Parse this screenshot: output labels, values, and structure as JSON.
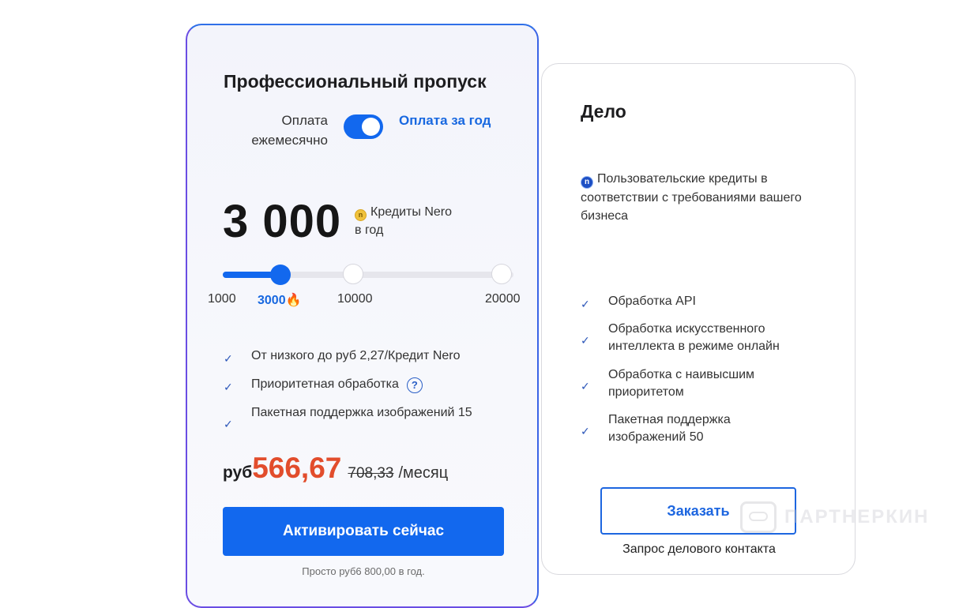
{
  "pro_card": {
    "title": "Профессиональный пропуск",
    "billing_monthly": "Оплата ежемесячно",
    "billing_yearly": "Оплата за год",
    "billing_toggle_on": true,
    "credits_amount": "3 000",
    "credits_label_line1": "Кредиты Nero",
    "credits_label_line2": "в год",
    "slider": {
      "options": [
        "1000",
        "3000",
        "10000",
        "20000"
      ],
      "selected": "3000",
      "selected_badge": "fire-icon"
    },
    "features": [
      "От низкого до руб 2,27/Кредит Nero",
      "Приоритетная обработка",
      "Пакетная поддержка изображений 15"
    ],
    "currency": "руб",
    "price_new": "566,67",
    "price_old": "708,33",
    "per_period": "/месяц",
    "activate_button": "Активировать сейчас",
    "note": "Просто руб6 800,00 в год."
  },
  "business_card": {
    "title": "Дело",
    "description": "Пользовательские кредиты в соответствии с требованиями вашего бизнеса",
    "features": [
      "Обработка API",
      "Обработка искусственного интеллекта в режиме онлайн",
      "Обработка с наивысшим приоритетом",
      "Пакетная поддержка изображений 50"
    ],
    "order_button": "Заказать",
    "contact_text": "Запрос делового контакта"
  },
  "watermark": {
    "text": "ПАРТНЕРКИН"
  },
  "colors": {
    "accent_blue": "#1268ee",
    "price_orange": "#e24d2c",
    "pro_border": "#6a4de3"
  }
}
